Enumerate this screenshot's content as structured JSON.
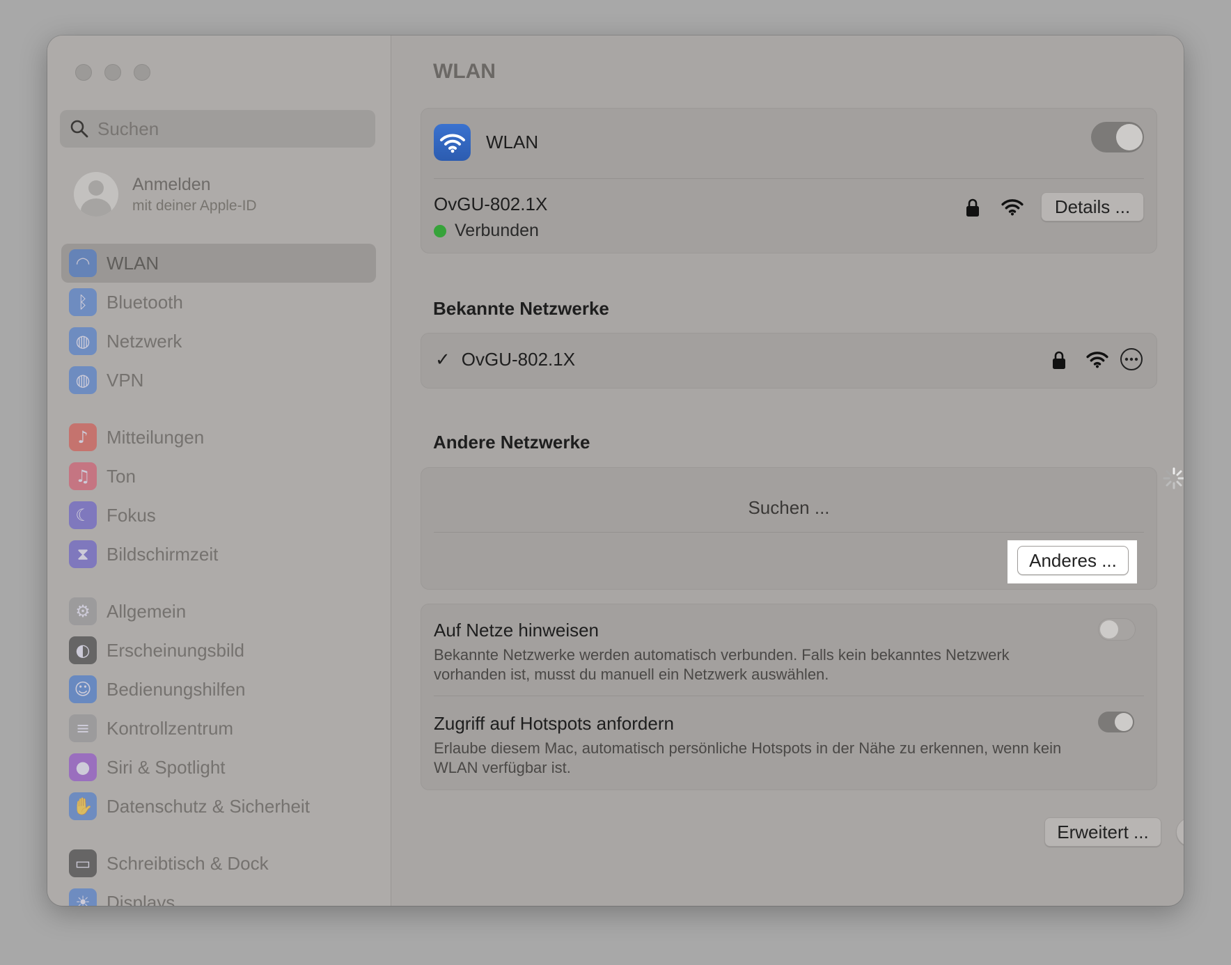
{
  "sidebar": {
    "search_placeholder": "Suchen",
    "account": {
      "title": "Anmelden",
      "subtitle": "mit deiner Apple-ID"
    },
    "groups": [
      [
        {
          "label": "WLAN",
          "icon": "wifi-icon",
          "color": "#3b73d3",
          "active": true
        },
        {
          "label": "Bluetooth",
          "icon": "bluetooth-icon",
          "color": "#3b73d3"
        },
        {
          "label": "Netzwerk",
          "icon": "globe-icon",
          "color": "#3b73d3"
        },
        {
          "label": "VPN",
          "icon": "vpn-globe-icon",
          "color": "#3b73d3"
        }
      ],
      [
        {
          "label": "Mitteilungen",
          "icon": "bell-icon",
          "color": "#d9463f"
        },
        {
          "label": "Ton",
          "icon": "speaker-icon",
          "color": "#d84a63"
        },
        {
          "label": "Fokus",
          "icon": "moon-icon",
          "color": "#5a4fcf"
        },
        {
          "label": "Bildschirmzeit",
          "icon": "hourglass-icon",
          "color": "#5a4fcf"
        }
      ],
      [
        {
          "label": "Allgemein",
          "icon": "gear-icon",
          "color": "#8e8e93"
        },
        {
          "label": "Erscheinungsbild",
          "icon": "appearance-icon",
          "color": "#2c2c2e"
        },
        {
          "label": "Bedienungshilfen",
          "icon": "accessibility-icon",
          "color": "#2f6fd3"
        },
        {
          "label": "Kontrollzentrum",
          "icon": "switches-icon",
          "color": "#8e8e93"
        },
        {
          "label": "Siri & Spotlight",
          "icon": "siri-icon",
          "color": "#8a3fd0"
        },
        {
          "label": "Datenschutz & Sicherheit",
          "icon": "hand-icon",
          "color": "#3b73d3"
        }
      ],
      [
        {
          "label": "Schreibtisch & Dock",
          "icon": "dock-icon",
          "color": "#2c2c2e"
        },
        {
          "label": "Displays",
          "icon": "sun-icon",
          "color": "#3b73d3"
        }
      ]
    ]
  },
  "main": {
    "title": "WLAN",
    "wifi_label": "WLAN",
    "wifi_enabled": true,
    "current": {
      "name": "OvGU-802.1X",
      "status": "Verbunden",
      "details_label": "Details ..."
    },
    "known_header": "Bekannte Netzwerke",
    "known": [
      {
        "name": "OvGU-802.1X",
        "check": "✓"
      }
    ],
    "other_header": "Andere Netzwerke",
    "searching": "Suchen ...",
    "other_button": "Anderes ...",
    "settings": [
      {
        "title": "Auf Netze hinweisen",
        "desc": "Bekannte Netzwerke werden automatisch verbunden. Falls kein bekanntes Netzwerk vorhanden ist, musst du manuell ein Netzwerk auswählen.",
        "enabled": false
      },
      {
        "title": "Zugriff auf Hotspots anfordern",
        "desc": "Erlaube diesem Mac, automatisch persönliche Hotspots in der Nähe zu erkennen, wenn kein WLAN verfügbar ist.",
        "enabled": true
      }
    ],
    "advanced_label": "Erweitert ...",
    "help_label": "?"
  }
}
